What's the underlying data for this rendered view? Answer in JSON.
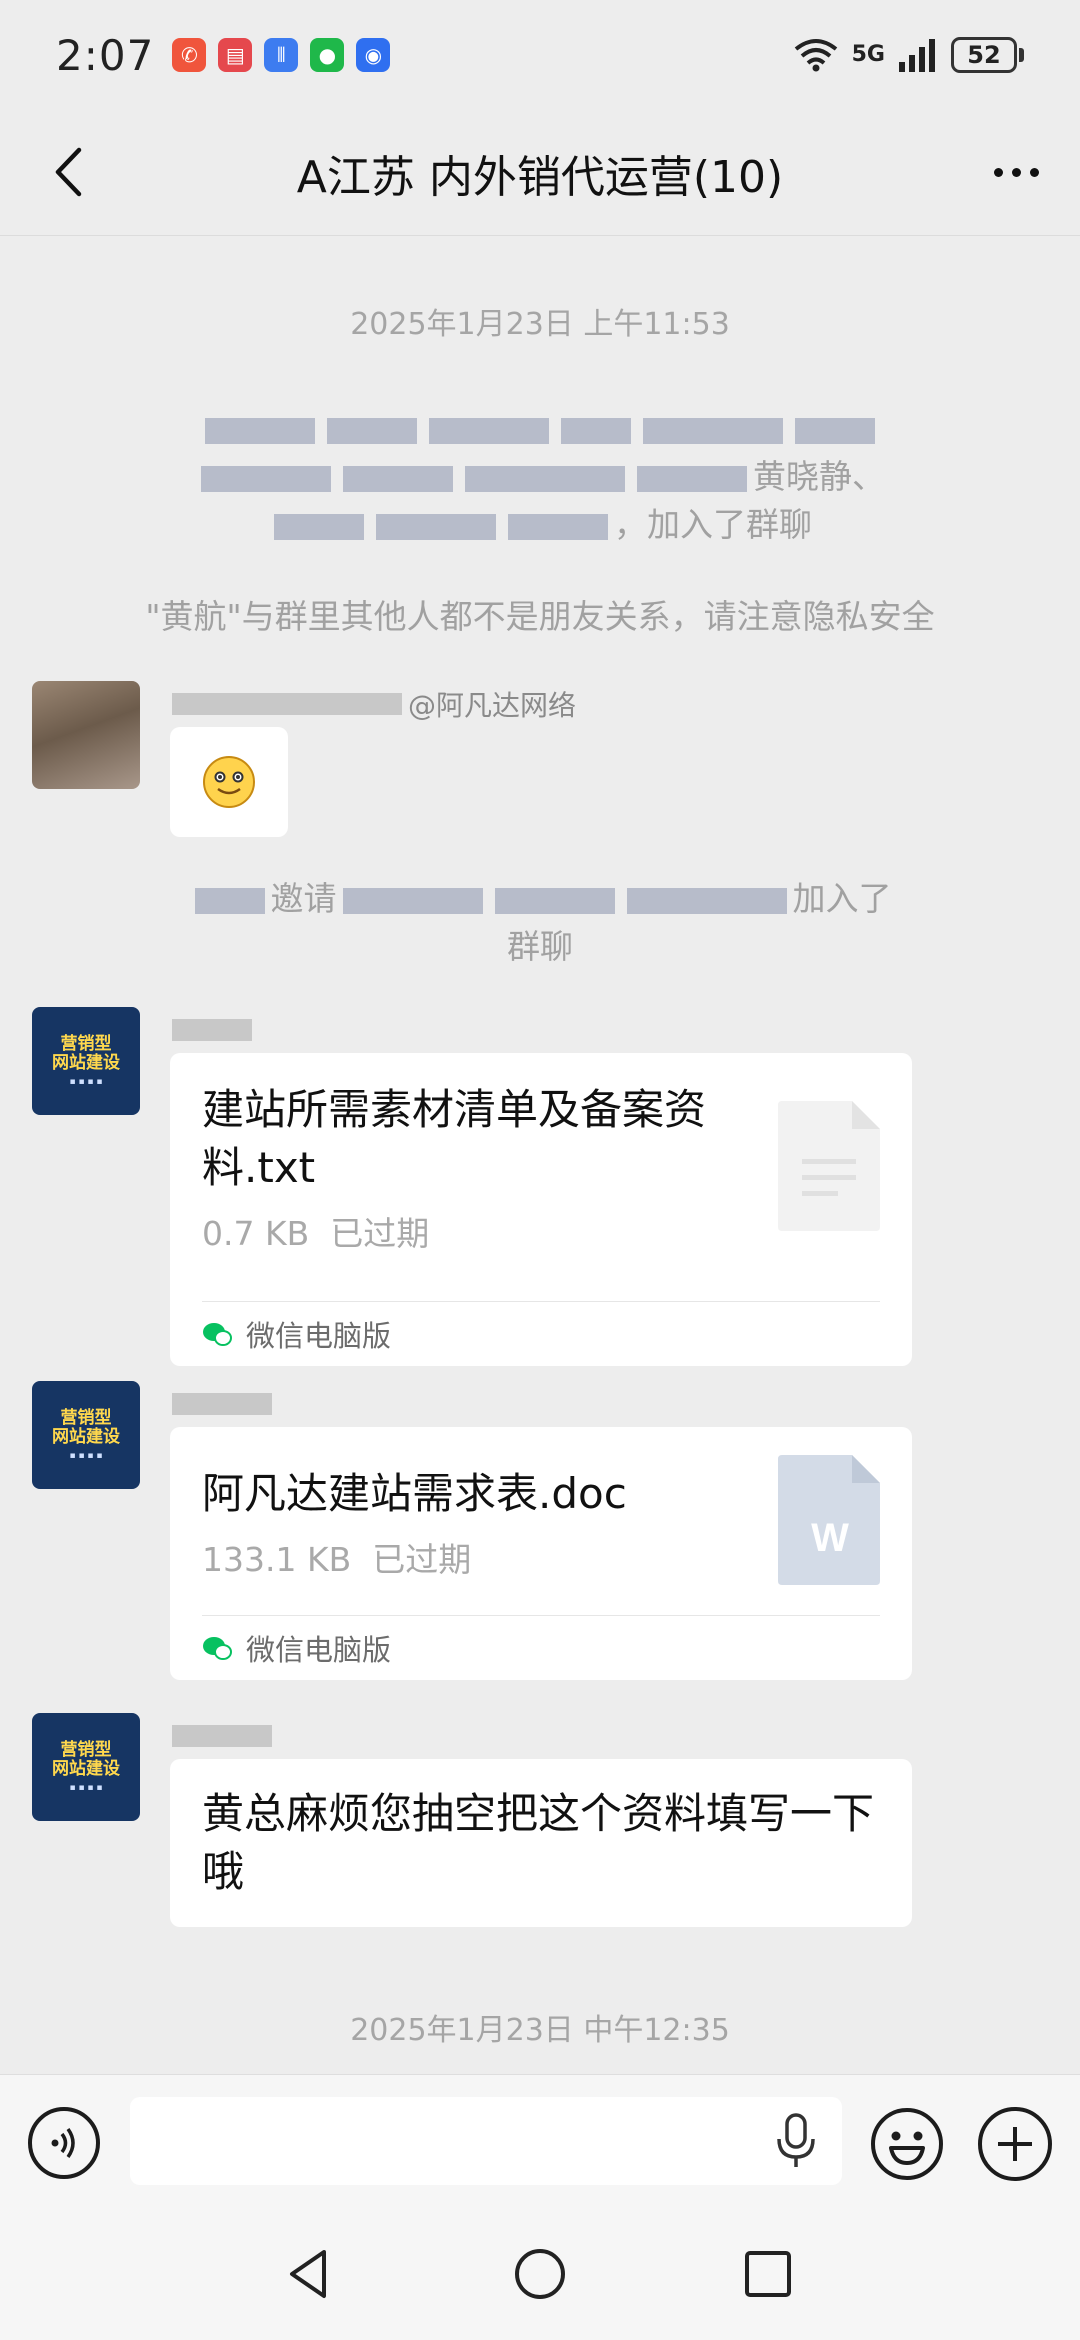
{
  "status_bar": {
    "time": "2:07",
    "network": "5G",
    "battery": "52"
  },
  "header": {
    "title": "A江苏   内外销代运营(10)"
  },
  "chat": {
    "timestamp_1": "2025年1月23日 上午11:53",
    "join_notice_fragment_1": "黄晓静、",
    "join_notice_fragment_2": "，加入了群聊",
    "privacy_notice": "\"黄航\"与群里其他人都不是朋友关系，请注意隐私安全",
    "msg1": {
      "sender_suffix": "@阿凡达网络"
    },
    "invite_notice_fragment_1": "邀请",
    "invite_notice_fragment_2": "加入了",
    "invite_notice_fragment_3": "群聊",
    "msg2": {
      "file_name": "建站所需素材清单及备案资料.txt",
      "file_size": "0.7 KB",
      "file_status": "已过期",
      "source": "微信电脑版"
    },
    "msg3": {
      "file_name": "阿凡达建站需求表.doc",
      "file_size": "133.1 KB",
      "file_status": "已过期",
      "source": "微信电脑版",
      "doc_icon_letter": "W"
    },
    "msg4": {
      "text": "黄总麻烦您抽空把这个资料填写一下哦"
    },
    "timestamp_2": "2025年1月23日 中午12:35",
    "avatar_brand": {
      "title_line1": "营销型",
      "title_line2": "网站建设"
    }
  },
  "colors": {
    "background": "#ededed",
    "bubble": "#ffffff",
    "brand_avatar": "#163563",
    "wechat_green": "#07c160"
  }
}
